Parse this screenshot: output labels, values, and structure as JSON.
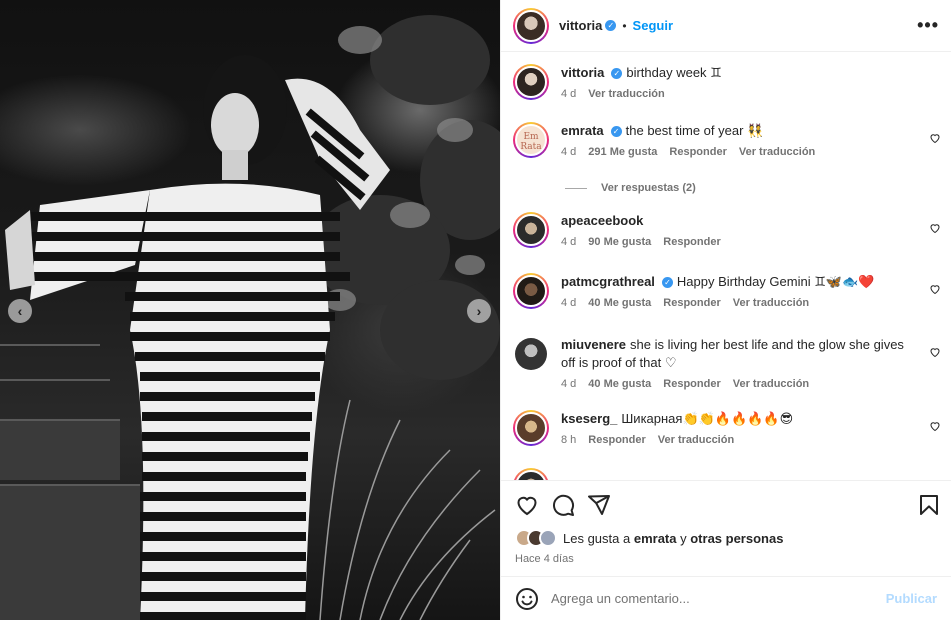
{
  "post": {
    "author": "vittoria",
    "follow_label": "Seguir",
    "more_label": "•••",
    "separator": "•"
  },
  "comments": [
    {
      "user": "vittoria",
      "text": "birthday week ♊",
      "time": "4 d",
      "likes": "",
      "reply": "",
      "translate": "Ver traducción",
      "verified": true
    },
    {
      "user": "emrata",
      "text": "the best time of year 👯",
      "time": "4 d",
      "likes": "291 Me gusta",
      "reply": "Responder",
      "translate": "Ver traducción",
      "verified": true,
      "avatar_text": "Em Rata"
    },
    {
      "user": "apeaceebook",
      "text": "",
      "time": "4 d",
      "likes": "90 Me gusta",
      "reply": "Responder",
      "translate": ""
    },
    {
      "user": "patmcgrathreal",
      "text": "Happy Birthday Gemini ♊🦋🐟❤️",
      "time": "4 d",
      "likes": "40 Me gusta",
      "reply": "Responder",
      "translate": "Ver traducción",
      "verified": true
    },
    {
      "user": "miuvenere",
      "text": "she is living her best life and the glow she gives off is proof of that ♡",
      "time": "4 d",
      "likes": "40 Me gusta",
      "reply": "Responder",
      "translate": "Ver traducción"
    },
    {
      "user": "kseserg_",
      "text": "Шикарная👏👏🔥🔥🔥🔥😎",
      "time": "8 h",
      "likes": "",
      "reply": "Responder",
      "translate": "Ver traducción"
    }
  ],
  "view_replies": "Ver respuestas (2)",
  "likes_line": {
    "prefix": "Les gusta a",
    "user": "emrata",
    "conj": "y",
    "others": "otras personas"
  },
  "posted_ago": "Hace 4 días",
  "composer": {
    "placeholder": "Agrega un comentario...",
    "publish_label": "Publicar"
  },
  "colors": {
    "accent": "#0095f6",
    "verified": "#3897f0",
    "publish_disabled": "#b3dbff"
  },
  "icons": [
    "chevron-left-icon",
    "chevron-right-icon",
    "more-icon",
    "heart-icon",
    "comment-icon",
    "share-icon",
    "bookmark-icon",
    "emoji-icon"
  ]
}
